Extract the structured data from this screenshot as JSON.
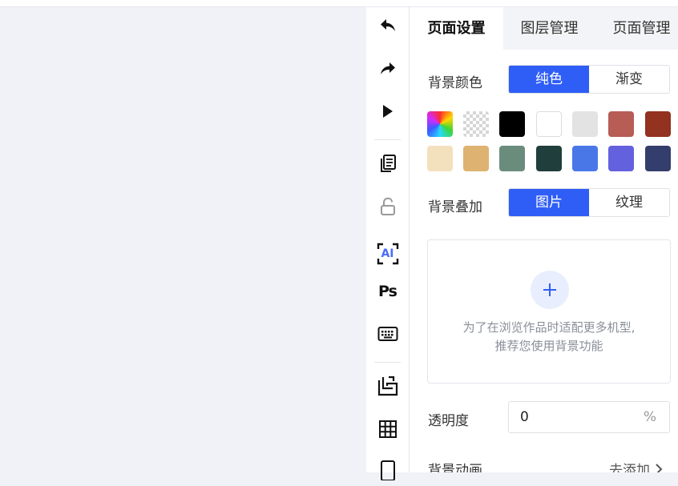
{
  "tabs": [
    {
      "label": "页面设置",
      "active": true
    },
    {
      "label": "图层管理",
      "active": false
    },
    {
      "label": "页面管理",
      "active": false
    }
  ],
  "background_color": {
    "label": "背景颜色",
    "options": [
      "纯色",
      "渐变"
    ],
    "selected": "纯色",
    "swatches": [
      [
        "rainbow-picker",
        "transparent",
        "#000000",
        "#ffffff",
        "#e3e3e3",
        "#b85c56",
        "#92321f"
      ],
      [
        "#f3e1bd",
        "#deb270",
        "#6a8c7c",
        "#203e3b",
        "#4a77e8",
        "#6461de",
        "#343e6c"
      ]
    ]
  },
  "background_overlay": {
    "label": "背景叠加",
    "options": [
      "图片",
      "纹理"
    ],
    "selected": "图片",
    "hint_line1": "为了在浏览作品时适配更多机型,",
    "hint_line2": "推荐您使用背景功能"
  },
  "opacity": {
    "label": "透明度",
    "value": "0",
    "unit": "%"
  },
  "background_animation": {
    "label": "背景动画",
    "action": "去添加"
  },
  "toolbar": {
    "icons": [
      "undo-icon",
      "redo-icon",
      "play-icon",
      "copy-icon",
      "unlock-icon",
      "ai-icon",
      "ps-icon",
      "keyboard-icon",
      "crop-icon",
      "grid-icon",
      "phone-icon"
    ],
    "ai_text": "AI",
    "ps_text": "Ps"
  },
  "colors": {
    "accent": "#2f5ef6",
    "canvas": "#f0f2f7"
  }
}
